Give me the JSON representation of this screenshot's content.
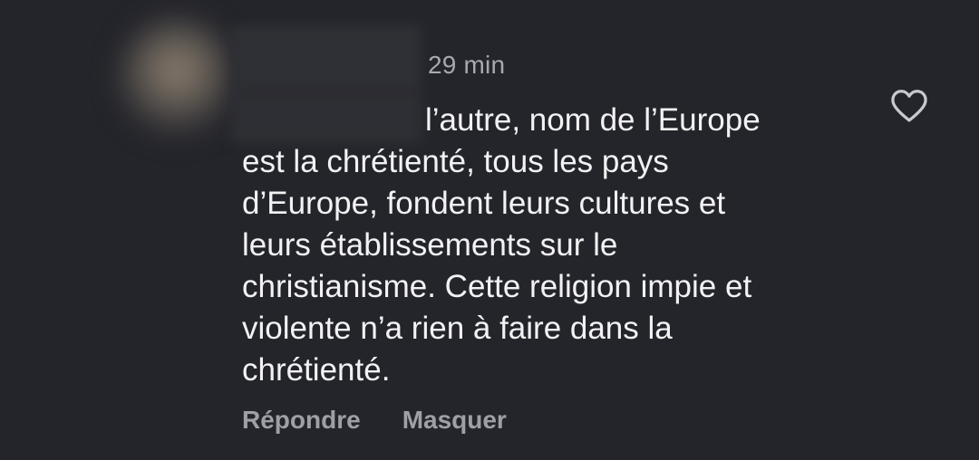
{
  "comment": {
    "timestamp": "29 min",
    "text_lines": [
      "l’autre, nom de l’Europe",
      "est la chrétienté, tous les pays",
      "d’Europe, fondent leurs cultures et",
      "leurs établissements sur le",
      "christianisme. Cette religion impie et",
      "violente n’a rien à faire dans la",
      "chrétienté."
    ],
    "like_icon": "heart-outline-icon",
    "actions": {
      "reply_label": "Répondre",
      "hide_label": "Masquer"
    }
  },
  "colors": {
    "background": "#24252b",
    "text": "#f2f2f4",
    "muted": "#a7a9b0",
    "icon": "#c8c9ce"
  }
}
